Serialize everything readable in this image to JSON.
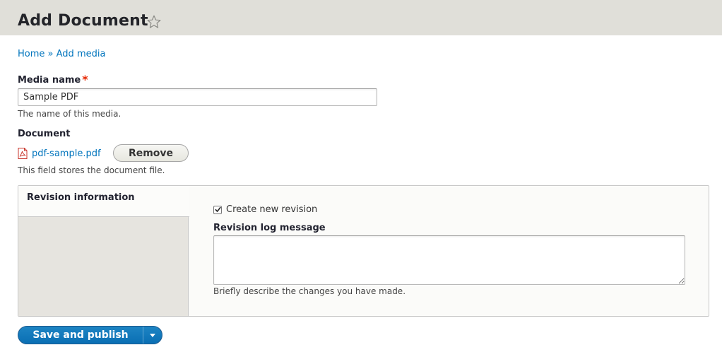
{
  "header": {
    "title": "Add Document",
    "star_icon": "star-outline-icon"
  },
  "breadcrumb": {
    "home": "Home",
    "separator": "»",
    "current": "Add media"
  },
  "form": {
    "media_name": {
      "label": "Media name",
      "required_mark": "*",
      "value": "Sample PDF",
      "description": "The name of this media."
    },
    "document": {
      "label": "Document",
      "file_icon": "pdf-file-icon",
      "file_name": "pdf-sample.pdf",
      "remove_label": "Remove",
      "description": "This field stores the document file."
    },
    "revision": {
      "tab_label": "Revision information",
      "create_revision_label": "Create new revision",
      "create_revision_checked": true,
      "log_label": "Revision log message",
      "log_value": "",
      "log_description": "Briefly describe the changes you have made."
    }
  },
  "actions": {
    "save_label": "Save and publish",
    "dropdown_icon": "caret-down-icon"
  },
  "colors": {
    "header_bg": "#e0dfd9",
    "link": "#0074bd",
    "primary_button": "#0a6fb4",
    "required": "#e62600"
  }
}
